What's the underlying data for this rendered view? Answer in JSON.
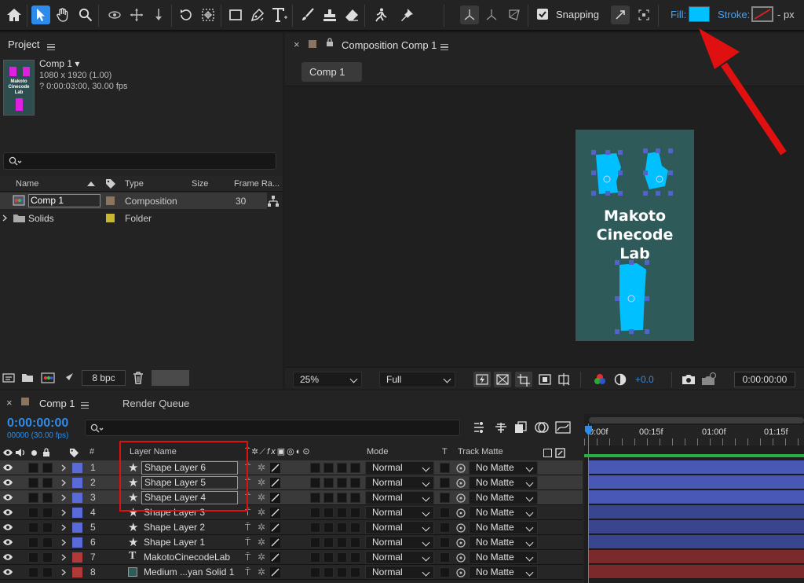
{
  "toolbar": {
    "snapping_label": "Snapping",
    "fill_label": "Fill:",
    "stroke_label": "Stroke:",
    "stroke_unit": "- px",
    "fill_color": "#00c0ff"
  },
  "project": {
    "title": "Project",
    "comp_name": "Comp 1",
    "comp_dims": "1080 x 1920 (1.00)",
    "comp_duration": "? 0:00:03:00, 30.00 fps",
    "thumb_text": "Makoto Cinecode Lab",
    "columns": {
      "name": "Name",
      "type": "Type",
      "size": "Size",
      "frame_rate": "Frame Ra..."
    },
    "items": [
      {
        "name": "Comp 1",
        "type": "Composition",
        "size": "",
        "frame_rate": "30",
        "color": "#8a7560"
      },
      {
        "name": "Solids",
        "type": "Folder",
        "size": "",
        "frame_rate": "",
        "color": "#c8b830"
      }
    ],
    "bpc": "8 bpc"
  },
  "composition": {
    "tab_label": "Composition Comp 1",
    "flowchart_tab": "Comp 1",
    "canvas_text": [
      "Makoto",
      "Cinecode",
      "Lab"
    ],
    "zoom": "25%",
    "resolution": "Full",
    "exposure": "+0.0",
    "timecode": "0:00:00:00"
  },
  "timeline": {
    "tabs": [
      {
        "label": "Comp 1"
      },
      {
        "label": "Render Queue"
      }
    ],
    "timecode": "0:00:00:00",
    "frames": "00000 (30.00 fps)",
    "ruler": [
      "0:00f",
      "00:15f",
      "01:00f",
      "01:15f"
    ],
    "headers": {
      "layer_name": "Layer Name",
      "mode": "Mode",
      "t": "T",
      "track_matte": "Track Matte",
      "number": "#"
    },
    "layers": [
      {
        "num": "1",
        "name": "Shape Layer 6",
        "type": "shape",
        "mode": "Normal",
        "matte": "No Matte",
        "label_color": "#5a6ad8",
        "selected": true
      },
      {
        "num": "2",
        "name": "Shape Layer 5",
        "type": "shape",
        "mode": "Normal",
        "matte": "No Matte",
        "label_color": "#5a6ad8",
        "selected": true
      },
      {
        "num": "3",
        "name": "Shape Layer 4",
        "type": "shape",
        "mode": "Normal",
        "matte": "No Matte",
        "label_color": "#5a6ad8",
        "selected": true
      },
      {
        "num": "4",
        "name": "Shape Layer 3",
        "type": "shape",
        "mode": "Normal",
        "matte": "No Matte",
        "label_color": "#5a6ad8",
        "selected": false
      },
      {
        "num": "5",
        "name": "Shape Layer 2",
        "type": "shape",
        "mode": "Normal",
        "matte": "No Matte",
        "label_color": "#5a6ad8",
        "selected": false
      },
      {
        "num": "6",
        "name": "Shape Layer 1",
        "type": "shape",
        "mode": "Normal",
        "matte": "No Matte",
        "label_color": "#5a6ad8",
        "selected": false
      },
      {
        "num": "7",
        "name": "MakotoCinecodeLab",
        "type": "text",
        "mode": "Normal",
        "matte": "No Matte",
        "label_color": "#b03a3a",
        "selected": false
      },
      {
        "num": "8",
        "name": "Medium ...yan Solid 1",
        "type": "solid",
        "mode": "Normal",
        "matte": "No Matte",
        "label_color": "#b03a3a",
        "selected": false
      }
    ]
  },
  "colors": {
    "accent": "#2d8ceb",
    "shape_fill": "#00c0ff",
    "canvas_bg": "#2e5a5a",
    "annotation_red": "#e01010"
  }
}
